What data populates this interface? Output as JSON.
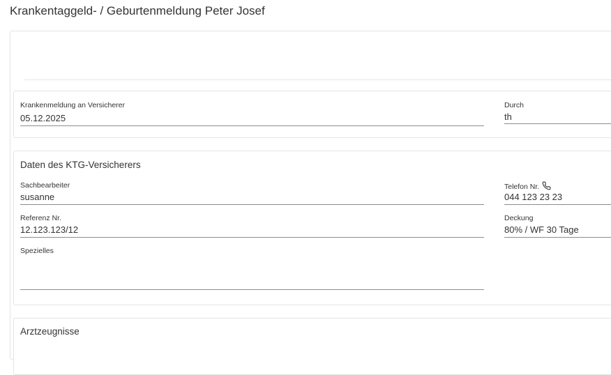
{
  "page": {
    "title": "Krankentaggeld- / Geburtenmeldung Peter Josef"
  },
  "krankenmeldung": {
    "date_label": "Krankenmeldung an Versicherer",
    "date_value": "05.12.2025",
    "durch_label": "Durch",
    "durch_value": "th"
  },
  "ktg": {
    "title": "Daten des KTG-Versicherers",
    "sachbearbeiter_label": "Sachbearbeiter",
    "sachbearbeiter_value": "susanne",
    "telefon_label": "Telefon Nr.",
    "telefon_icon": "phone-icon",
    "telefon_value": "044 123 23 23",
    "referenz_label": "Referenz Nr.",
    "referenz_value": "12.123.123/12",
    "deckung_label": "Deckung",
    "deckung_value": "80% / WF 30 Tage",
    "spezielles_label": "Spezielles",
    "spezielles_value": ""
  },
  "arzt": {
    "title": "Arztzeugnisse"
  }
}
